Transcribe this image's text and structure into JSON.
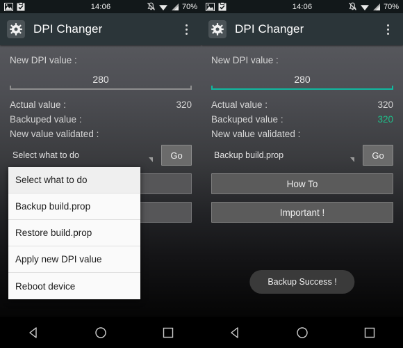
{
  "status_bar": {
    "time": "14:06",
    "battery": "70%",
    "left_icons": [
      "image-icon",
      "clipboard-check-icon"
    ],
    "right_icons": [
      "notifications-off-icon",
      "wifi-icon",
      "signal-icon"
    ]
  },
  "app_bar": {
    "icon": "gear-icon",
    "title": "DPI Changer",
    "overflow": "overflow-menu-icon"
  },
  "colors": {
    "accent_teal": "#10b9a0",
    "value_green": "#1fc08a",
    "app_bar": "#2b3539"
  },
  "left": {
    "new_dpi_label": "New DPI value :",
    "new_dpi_value": "280",
    "actual_label": "Actual value :",
    "actual_value": "320",
    "backuped_label": "Backuped value :",
    "backuped_value": "",
    "validated_label": "New value validated :",
    "validated_value": "",
    "spinner_value": "Select what to do",
    "go_label": "Go",
    "button_howto": "",
    "button_important": "",
    "dropdown_open": true,
    "dropdown_items": [
      "Select what to do",
      "Backup build.prop",
      "Restore build.prop",
      "Apply new DPI value",
      "Reboot device"
    ]
  },
  "right": {
    "new_dpi_label": "New DPI value :",
    "new_dpi_value": "280",
    "actual_label": "Actual value :",
    "actual_value": "320",
    "backuped_label": "Backuped value :",
    "backuped_value": "320",
    "validated_label": "New value validated :",
    "validated_value": "",
    "spinner_value": "Backup build.prop",
    "go_label": "Go",
    "button_howto": "How To",
    "button_important": "Important !",
    "toast": "Backup Success !"
  },
  "nav_bar": {
    "back": "back-icon",
    "home": "home-icon",
    "recents": "recents-icon"
  }
}
